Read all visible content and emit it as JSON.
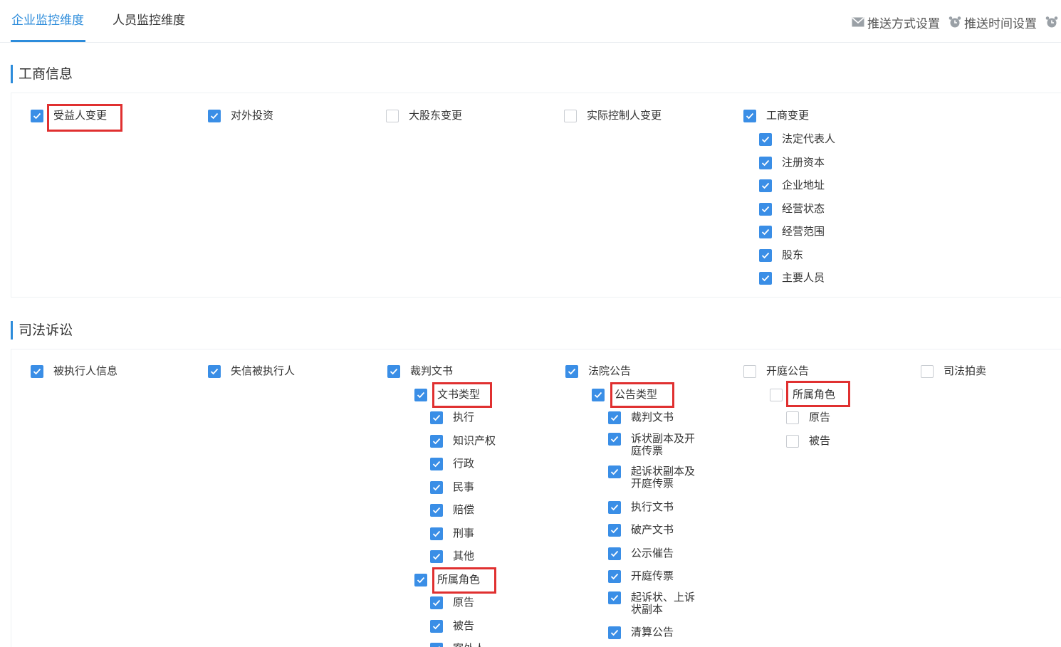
{
  "tabs": [
    "企业监控维度",
    "人员监控维度"
  ],
  "toolbar": {
    "push_method": "推送方式设置",
    "push_time": "推送时间设置"
  },
  "sections": {
    "business": {
      "title": "工商信息",
      "items": {
        "beneficiary_change": "受益人变更",
        "outward_investment": "对外投资",
        "major_shareholder_change": "大股东变更",
        "actual_controller_change": "实际控制人变更",
        "business_change": "工商变更"
      },
      "business_change_sub": [
        "法定代表人",
        "注册资本",
        "企业地址",
        "经营状态",
        "经营范围",
        "股东",
        "主要人员"
      ]
    },
    "judicial": {
      "title": "司法诉讼",
      "items": {
        "executed_person": "被执行人信息",
        "dishonest_executed": "失信被执行人",
        "judgment_docs": "裁判文书",
        "court_notice": "法院公告",
        "hearing_notice": "开庭公告",
        "judicial_auction": "司法拍卖"
      },
      "judgment": {
        "doc_type": "文书类型",
        "doc_types": [
          "执行",
          "知识产权",
          "行政",
          "民事",
          "赔偿",
          "刑事",
          "其他"
        ],
        "role": "所属角色",
        "roles": [
          "原告",
          "被告",
          "案外人"
        ]
      },
      "court": {
        "notice_type": "公告类型",
        "notice_types": [
          "裁判文书",
          "诉状副本及开庭传票",
          "起诉状副本及开庭传票",
          "执行文书",
          "破产文书",
          "公示催告",
          "开庭传票",
          "起诉状、上诉状副本",
          "清算公告"
        ]
      },
      "hearing": {
        "role": "所属角色",
        "roles": [
          "原告",
          "被告"
        ]
      }
    }
  },
  "colors": {
    "accent": "#2d8cdb",
    "checkbox": "#3a8ee6",
    "highlight": "#e03030"
  }
}
